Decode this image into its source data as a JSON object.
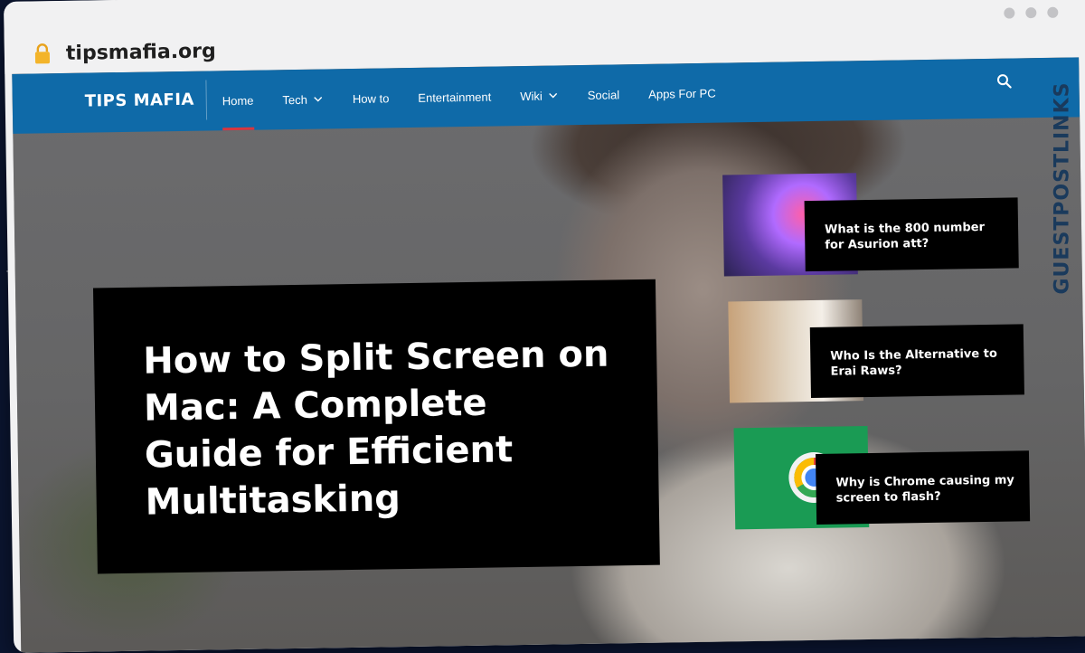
{
  "browser": {
    "url": "tipsmafia.org"
  },
  "site": {
    "logo": "TIPS MAFIA",
    "nav": [
      {
        "label": "Home",
        "active": true
      },
      {
        "label": "Tech",
        "dropdown": true
      },
      {
        "label": "How to"
      },
      {
        "label": "Entertainment"
      },
      {
        "label": "Wiki",
        "dropdown": true
      },
      {
        "label": "Social"
      },
      {
        "label": "Apps For PC"
      }
    ],
    "accent_color": "#0f6aa8",
    "active_indicator_color": "#d9363e"
  },
  "hero": {
    "headline": "How to Split Screen on Mac: A Complete Guide for Efficient Multitasking"
  },
  "side_posts": [
    {
      "title": "What is the 800 number for Asurion att?"
    },
    {
      "title": "Who Is the Alternative to Erai Raws?"
    },
    {
      "title": "Why is Chrome causing my screen to flash?"
    }
  ],
  "watermark": {
    "text": "GUESTPOSTLINKS"
  }
}
